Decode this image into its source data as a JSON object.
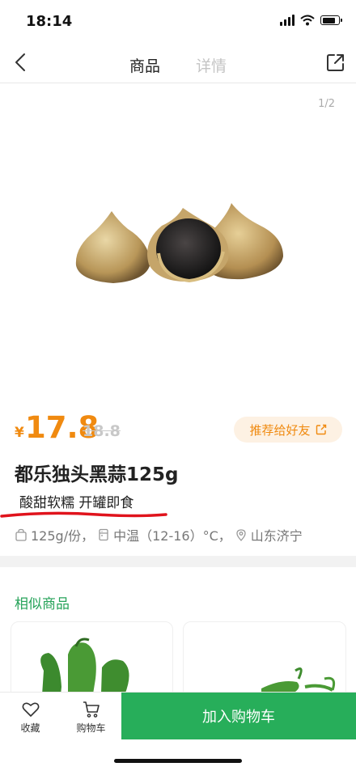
{
  "status": {
    "time": "18:14",
    "battery_level": 0.85
  },
  "nav": {
    "tabs": [
      "商品",
      "详情"
    ],
    "active_tab": "商品",
    "icons": [
      "back-icon",
      "share-icon"
    ]
  },
  "gallery": {
    "pager": "1/2"
  },
  "product": {
    "currency": "¥",
    "price": "17.8",
    "original_price": "18.8",
    "recommend_label": "推荐给好友",
    "title": "都乐独头黑蒜125g",
    "subtitle": "酸甜软糯 开罐即食",
    "specs": {
      "size": "125g/份，",
      "storage": "中温（12-16）°C，",
      "origin": "山东济宁"
    }
  },
  "similar": {
    "title": "相似商品"
  },
  "bottom_bar": {
    "favorite_label": "收藏",
    "cart_label": "购物车",
    "add_to_cart_label": "加入购物车"
  },
  "colors": {
    "price": "#f08a10",
    "accent_green": "#27ae5a",
    "annotation_red": "#e0131c"
  }
}
